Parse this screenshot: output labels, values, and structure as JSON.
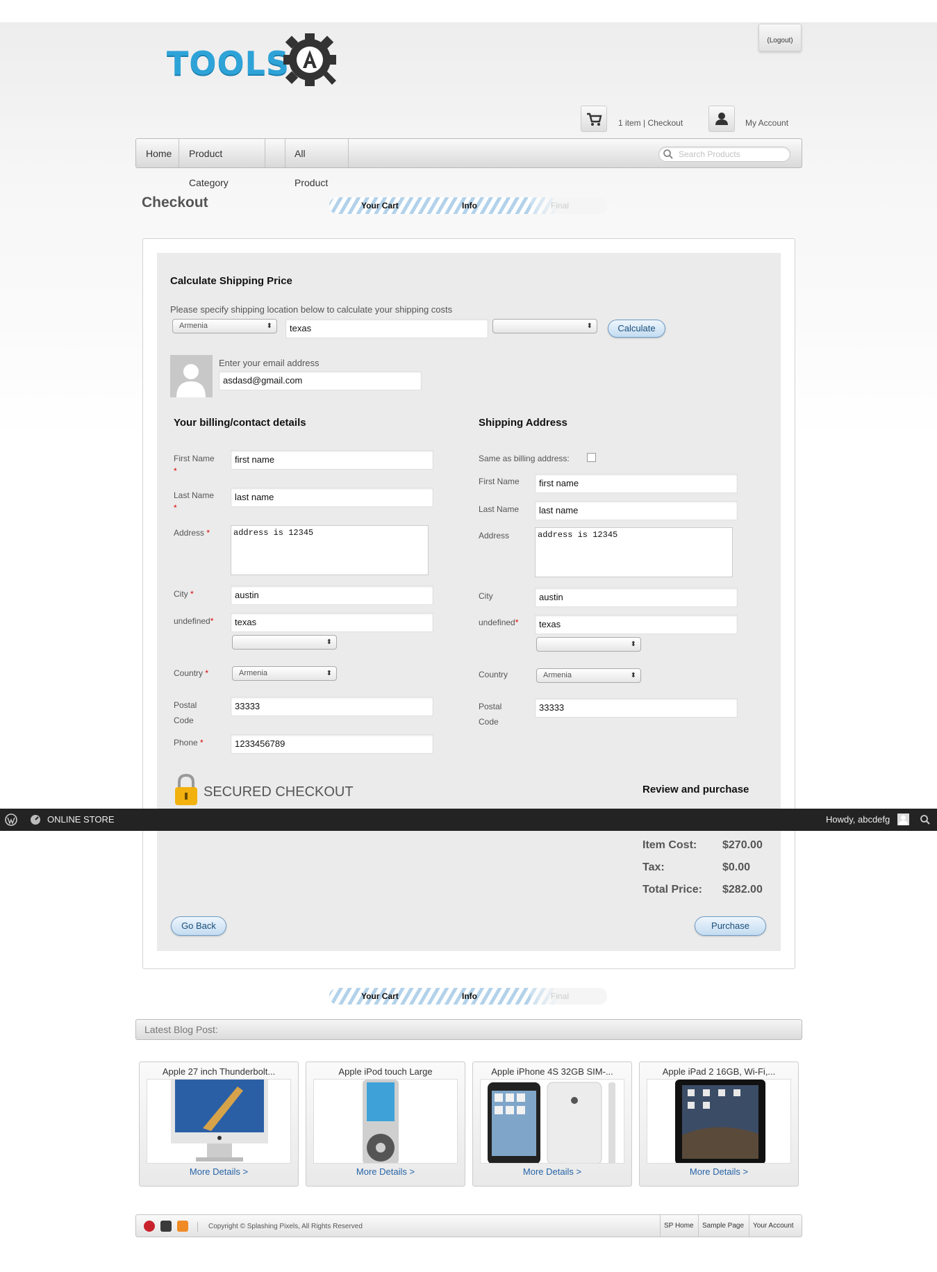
{
  "header": {
    "logo_text": "TOOLS",
    "logout_label": "(Logout)",
    "cart_text": "1 item | Checkout",
    "account_label": "My Account"
  },
  "nav": {
    "items": [
      "Home",
      "Product Category",
      "",
      "All Product"
    ],
    "search_placeholder": "Search Products"
  },
  "checkout": {
    "title": "Checkout",
    "steps": [
      "Your Cart",
      "Info",
      "Final"
    ]
  },
  "shipping_calc": {
    "heading": "Calculate Shipping Price",
    "instruction": "Please specify shipping location below to calculate your shipping costs",
    "country": "Armenia",
    "state_value": "texas",
    "region": "",
    "calculate_label": "Calculate"
  },
  "email": {
    "label": "Enter your email address",
    "value": "asdasd@gmail.com"
  },
  "billing": {
    "heading": "Your billing/contact details",
    "first_name_label": "First Name",
    "first_name": "first name",
    "last_name_label": "Last Name",
    "last_name": "last name",
    "address_label": "Address",
    "address": "address is 12345",
    "city_label": "City",
    "city": "austin",
    "state_label": "undefined",
    "state": "texas",
    "region": "",
    "country_label": "Country",
    "country": "Armenia",
    "postal_label": "Postal Code",
    "postal": "33333",
    "phone_label": "Phone",
    "phone": "1233456789"
  },
  "shipping_addr": {
    "heading": "Shipping Address",
    "same_label": "Same as billing address:",
    "first_name_label": "First Name",
    "first_name": "first name",
    "last_name_label": "Last Name",
    "last_name": "last name",
    "address_label": "Address",
    "address": "address is 12345",
    "city_label": "City",
    "city": "austin",
    "state_label": "undefined",
    "state": "texas",
    "region": "",
    "country_label": "Country",
    "country": "Armenia",
    "postal_label": "Postal Code",
    "postal": "33333"
  },
  "secured_label": "SECURED CHECKOUT",
  "review": {
    "heading": "Review and purchase",
    "item_cost_label": "Item Cost:",
    "item_cost": "$270.00",
    "tax_label": "Tax:",
    "tax": "$0.00",
    "total_label": "Total Price:",
    "total": "$282.00",
    "go_back_label": "Go Back",
    "purchase_label": "Purchase"
  },
  "admin_bar": {
    "site_name": "ONLINE STORE",
    "greeting": "Howdy, abcdefg"
  },
  "blog": {
    "title": "Latest Blog Post:",
    "more_label": "More Details >",
    "posts": [
      {
        "title": "Apple 27 inch Thunderbolt..."
      },
      {
        "title": "Apple iPod touch Large"
      },
      {
        "title": "Apple iPhone 4S 32GB SIM-..."
      },
      {
        "title": "Apple iPad 2 16GB, Wi-Fi,..."
      }
    ]
  },
  "footer": {
    "copyright": "Copyright © Splashing Pixels, All Rights Reserved",
    "links": [
      "SP Home",
      "Sample Page",
      "Your Account"
    ]
  },
  "colors": {
    "accent": "#2ea3d8",
    "link": "#2563a6",
    "button_border": "#6f9bc4",
    "admin_bar": "#232323"
  }
}
